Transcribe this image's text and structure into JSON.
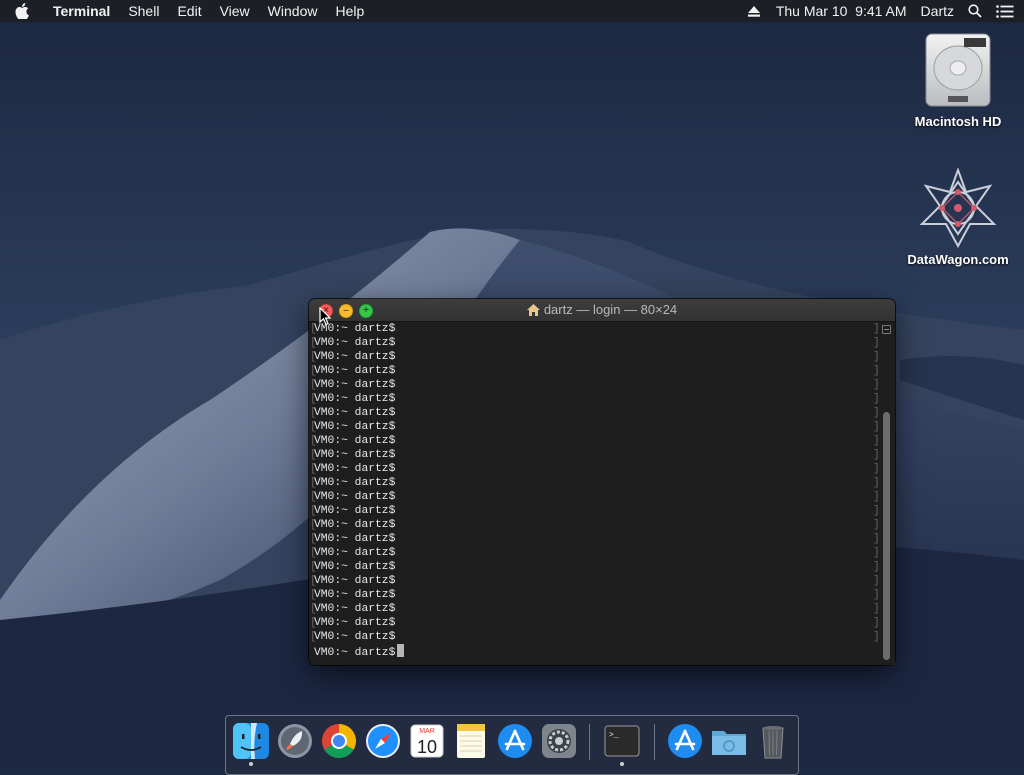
{
  "menubar": {
    "app_name": "Terminal",
    "items": [
      "Shell",
      "Edit",
      "View",
      "Window",
      "Help"
    ],
    "datetime": "Thu Mar 10  9:41 AM",
    "user": "Dartz"
  },
  "desktop": {
    "icons": [
      {
        "label": "Macintosh HD",
        "icon": "hard-drive-icon"
      },
      {
        "label": "DataWagon.com",
        "icon": "datawagon-logo-icon"
      }
    ]
  },
  "terminal": {
    "title": "dartz — login — 80×24",
    "lines": [
      "VM0:~ dartz$",
      "VM0:~ dartz$",
      "VM0:~ dartz$",
      "VM0:~ dartz$",
      "VM0:~ dartz$",
      "VM0:~ dartz$",
      "VM0:~ dartz$",
      "VM0:~ dartz$",
      "VM0:~ dartz$",
      "VM0:~ dartz$",
      "VM0:~ dartz$",
      "VM0:~ dartz$",
      "VM0:~ dartz$",
      "VM0:~ dartz$",
      "VM0:~ dartz$",
      "VM0:~ dartz$",
      "VM0:~ dartz$",
      "VM0:~ dartz$",
      "VM0:~ dartz$",
      "VM0:~ dartz$",
      "VM0:~ dartz$",
      "VM0:~ dartz$",
      "VM0:~ dartz$",
      "VM0:~ dartz$"
    ],
    "scroll_position": 0.27
  },
  "dock": {
    "items": [
      {
        "name": "finder",
        "running": true
      },
      {
        "name": "launchpad",
        "running": false
      },
      {
        "name": "chrome",
        "running": false
      },
      {
        "name": "safari",
        "running": false
      },
      {
        "name": "calendar",
        "running": false,
        "month": "MAR",
        "day": "10"
      },
      {
        "name": "notes",
        "running": false
      },
      {
        "name": "app-store",
        "running": false
      },
      {
        "name": "system-preferences",
        "running": false
      },
      {
        "name": "terminal",
        "running": true
      },
      {
        "name": "applications-stack",
        "running": false
      },
      {
        "name": "downloads-folder",
        "running": false
      },
      {
        "name": "trash",
        "running": false
      }
    ]
  },
  "colors": {
    "close": "#fd5b59",
    "minimize": "#f9bc2e",
    "zoom": "#34c748",
    "terminal_bg": "#1e1e1e"
  }
}
